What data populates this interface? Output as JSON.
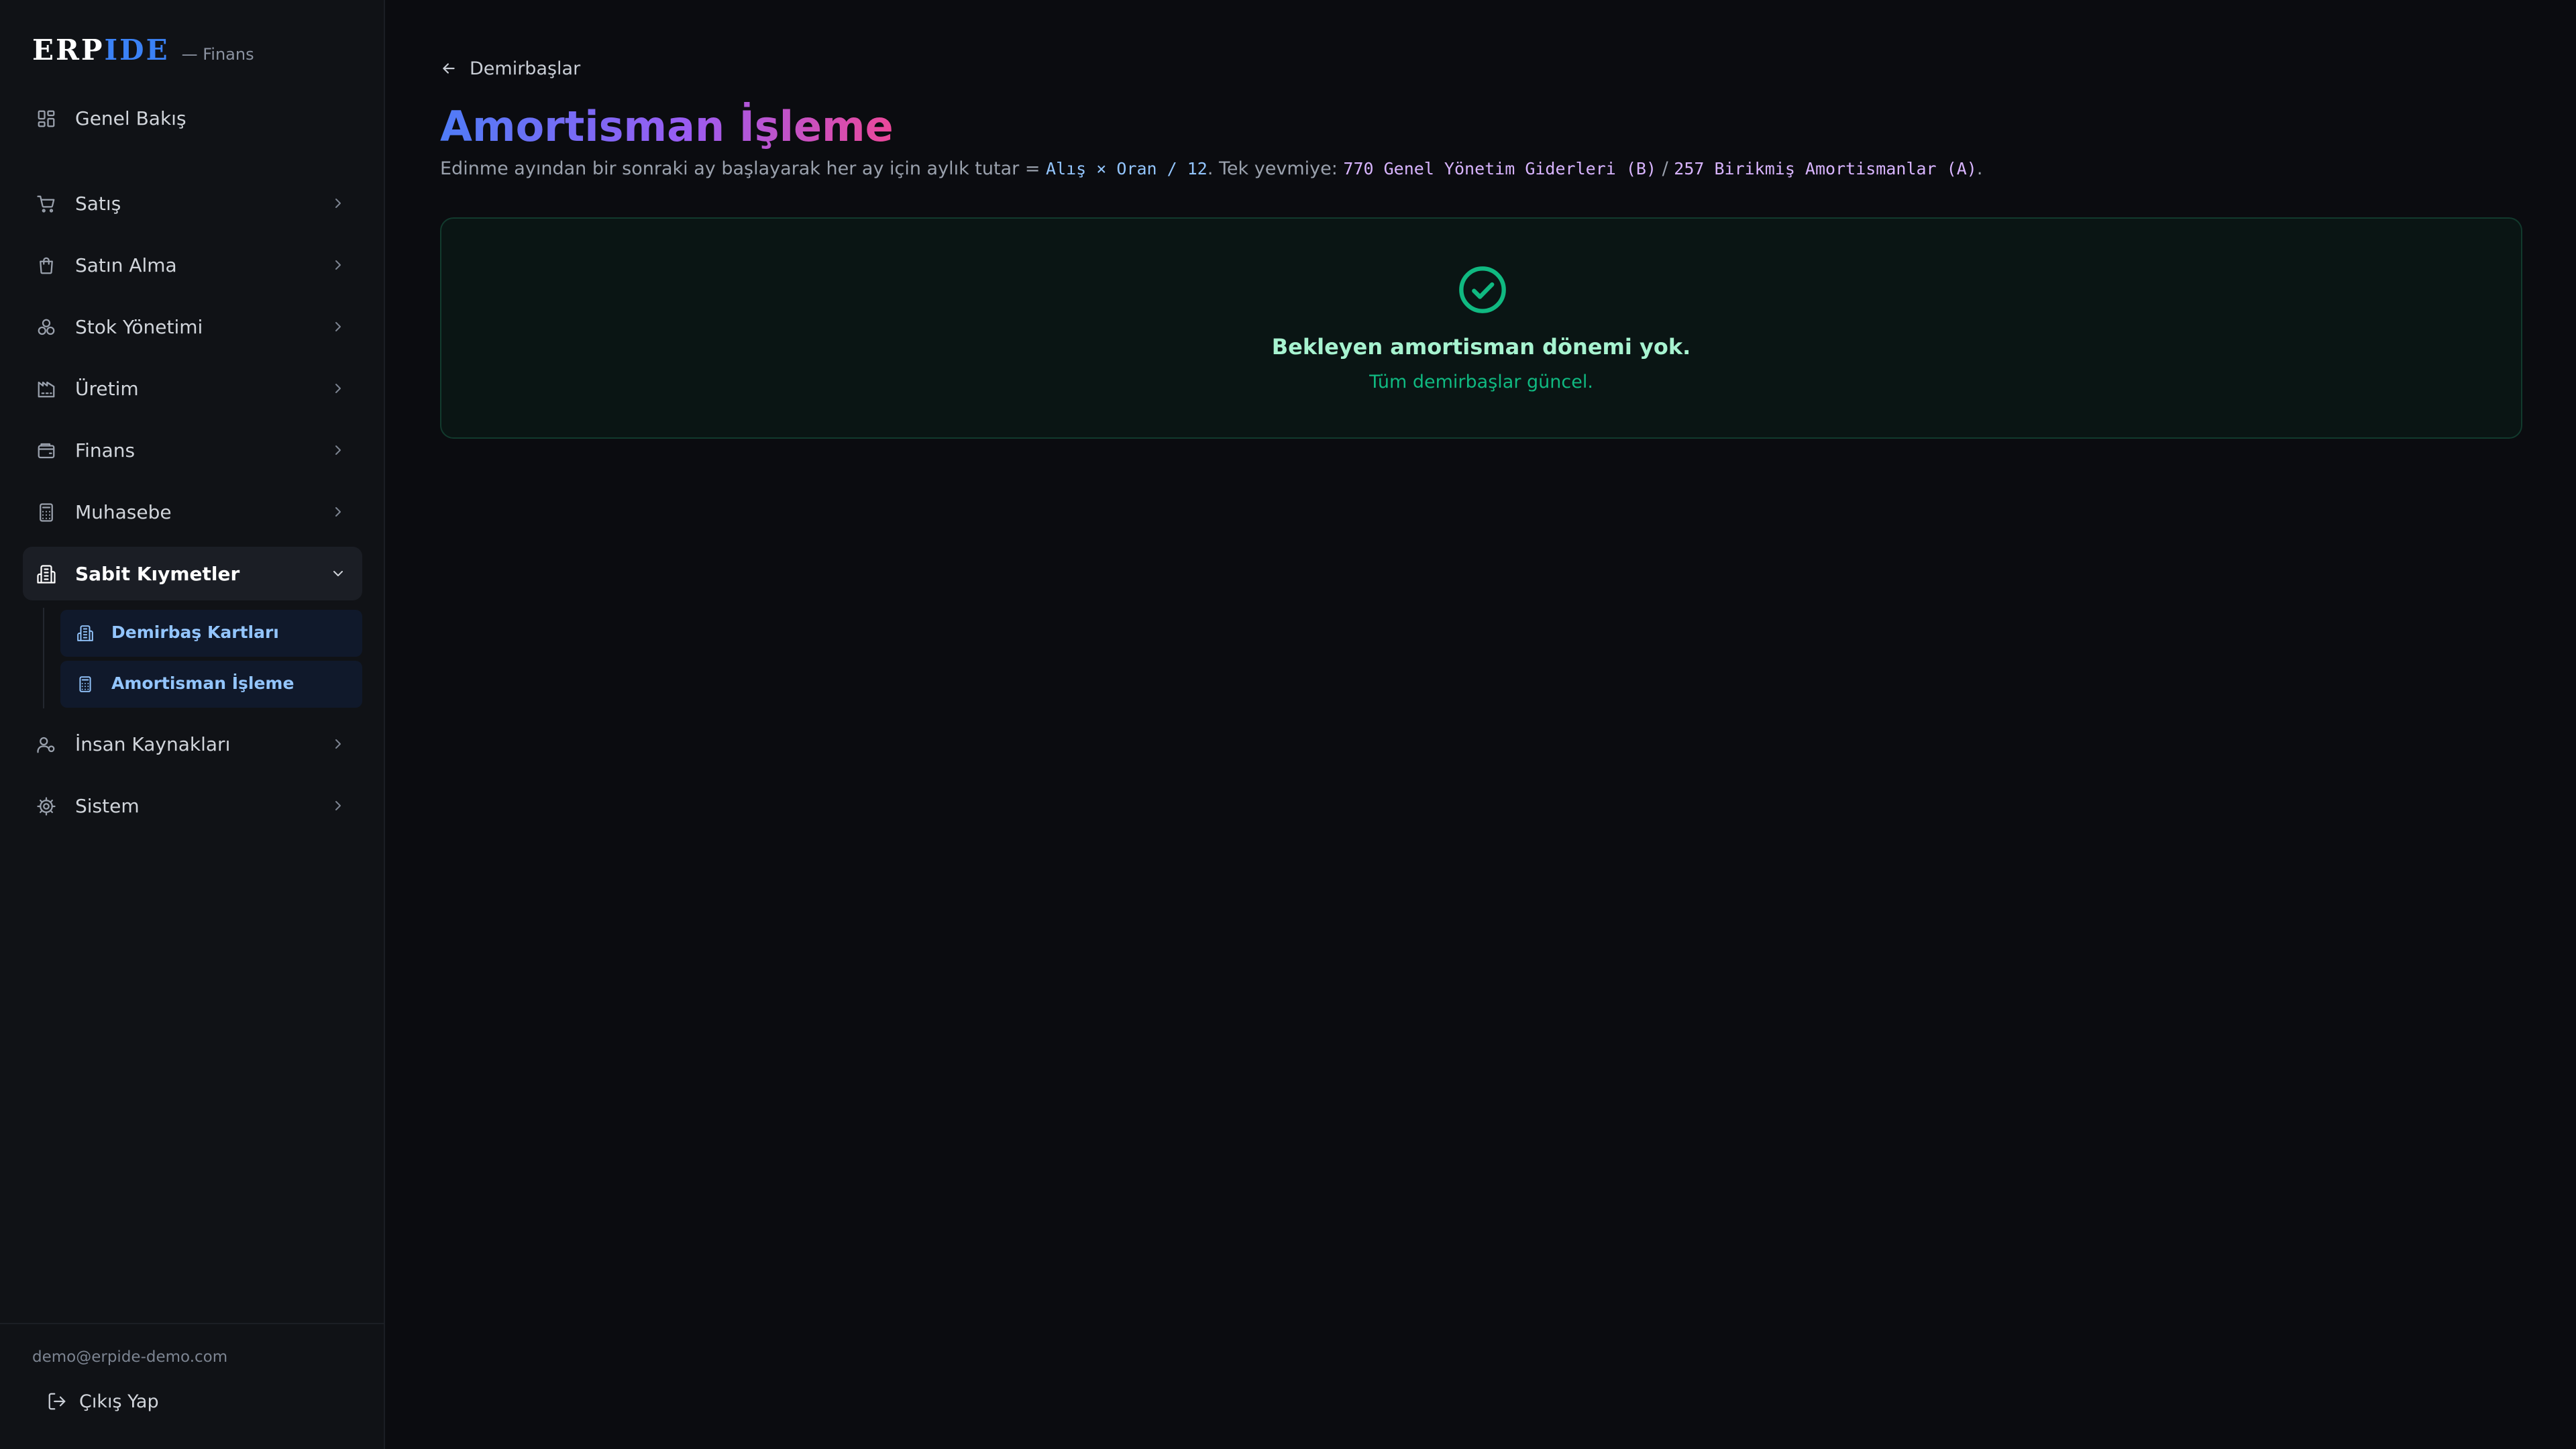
{
  "brand": {
    "logo_erp": "ERP",
    "logo_ide": "IDE",
    "subtitle": "— Finans"
  },
  "sidebar": {
    "overview": "Genel Bakış",
    "items": [
      {
        "label": "Satış",
        "icon": "cart-icon"
      },
      {
        "label": "Satın Alma",
        "icon": "shopping-bag-icon"
      },
      {
        "label": "Stok Yönetimi",
        "icon": "boxes-icon"
      },
      {
        "label": "Üretim",
        "icon": "factory-icon"
      },
      {
        "label": "Finans",
        "icon": "wallet-icon"
      },
      {
        "label": "Muhasebe",
        "icon": "calculator-icon"
      },
      {
        "label": "Sabit Kıymetler",
        "icon": "building-icon",
        "expanded": true
      },
      {
        "label": "İnsan Kaynakları",
        "icon": "users-icon"
      },
      {
        "label": "Sistem",
        "icon": "settings-icon"
      }
    ],
    "sub_items": [
      {
        "label": "Demirbaş Kartları",
        "icon": "building-icon"
      },
      {
        "label": "Amortisman İşleme",
        "icon": "calculator-icon",
        "active": true
      }
    ],
    "user_email": "demo@erpide-demo.com",
    "logout": "Çıkış Yap"
  },
  "main": {
    "back_label": "Demirbaşlar",
    "title": "Amortisman İşleme",
    "desc": {
      "part1": "Edinme ayından bir sonraki ay başlayarak her ay için aylık tutar = ",
      "formula": "Alış × Oran / 12",
      "part2": ". Tek yevmiye: ",
      "debit": "770 Genel Yönetim Giderleri (B)",
      "sep": " / ",
      "credit": "257 Birikmiş Amortismanlar (A)",
      "end": "."
    },
    "empty": {
      "title": "Bekleyen amortisman dönemi yok.",
      "subtitle": "Tüm demirbaşlar güncel."
    }
  },
  "colors": {
    "accent": "#3b82f6",
    "success": "#10b981",
    "title_gradient": [
      "#4f7cf7",
      "#9b5cf2",
      "#ec4899"
    ]
  }
}
